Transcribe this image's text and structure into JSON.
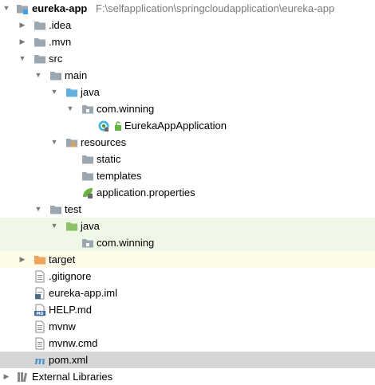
{
  "project": {
    "name": "eureka-app",
    "path": "F:\\selfapplication\\springcloudapplication\\eureka-app"
  },
  "tree": {
    "idea": ".idea",
    "mvn": ".mvn",
    "src": "src",
    "main": "main",
    "java": "java",
    "com_winning": "com.winning",
    "app_class": "EurekaAppApplication",
    "resources": "resources",
    "static": "static",
    "templates": "templates",
    "app_properties": "application.properties",
    "test": "test",
    "test_java": "java",
    "test_com_winning": "com.winning",
    "target": "target",
    "gitignore": ".gitignore",
    "iml": "eureka-app.iml",
    "help": "HELP.md",
    "mvnw": "mvnw",
    "mvnw_cmd": "mvnw.cmd",
    "pom": "pom.xml",
    "external_libraries": "External Libraries"
  },
  "icons": {
    "project": "module-folder-icon",
    "folder": "folder-icon",
    "source_folder": "source-root-folder-icon",
    "test_folder": "test-root-folder-icon",
    "resources_folder": "resources-root-folder-icon",
    "excluded_folder": "excluded-folder-icon",
    "package": "package-icon",
    "spring_boot_class": "spring-boot-class-icon",
    "spring_properties": "spring-properties-icon",
    "text_file": "text-file-icon",
    "iml_file": "iml-file-icon",
    "markdown_file": "markdown-file-icon",
    "maven_file": "maven-pom-icon",
    "libraries": "libraries-icon"
  },
  "colors": {
    "folder": "#9aa7b0",
    "source_folder": "#62b0de",
    "test_folder": "#8cc069",
    "excluded_folder": "#f0a35c",
    "selected_row": "#d6d6d6",
    "test_row": "#eff8e7",
    "excluded_row": "#fefce9"
  }
}
